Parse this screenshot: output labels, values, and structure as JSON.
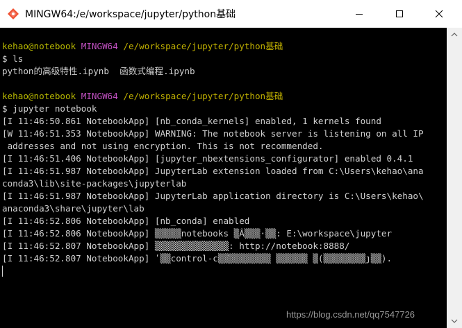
{
  "window": {
    "title": "MINGW64:/e/workspace/jupyter/python基础",
    "icon": "git-bash-diamond-icon",
    "controls": [
      "minimize-icon",
      "maximize-icon",
      "close-icon"
    ]
  },
  "colors": {
    "user": "#b8b800",
    "mingw": "#c050c0",
    "path": "#c0b000",
    "text": "#d0d0d0",
    "background": "#000000"
  },
  "terminal": {
    "prompt1": {
      "user": "kehao@notebook",
      "env": "MINGW64",
      "path": "/e/workspace/jupyter/python基础"
    },
    "cmd1": "$ ls",
    "out1": "python的高级特性.ipynb  函数式编程.ipynb",
    "prompt2": {
      "user": "kehao@notebook",
      "env": "MINGW64",
      "path": "/e/workspace/jupyter/python基础"
    },
    "cmd2": "$ jupyter notebook",
    "log": [
      "[I 11:46:50.861 NotebookApp] [nb_conda_kernels] enabled, 1 kernels found",
      "[W 11:46:51.353 NotebookApp] WARNING: The notebook server is listening on all IP",
      " addresses and not using encryption. This is not recommended.",
      "[I 11:46:51.406 NotebookApp] [jupyter_nbextensions_configurator] enabled 0.4.1",
      "[I 11:46:51.987 NotebookApp] JupyterLab extension loaded from C:\\Users\\kehao\\ana",
      "conda3\\lib\\site-packages\\jupyterlab",
      "[I 11:46:51.987 NotebookApp] JupyterLab application directory is C:\\Users\\kehao\\",
      "anaconda3\\share\\jupyter\\lab",
      "[I 11:46:52.806 NotebookApp] [nb_conda] enabled",
      "[I 11:46:52.806 NotebookApp] ▒▒▒▒▒notebooks ▒Â▒▒▒·▒▒: E:\\workspace\\jupyter",
      "[I 11:46:52.807 NotebookApp] ▒▒▒▒▒▒▒▒▒▒▒▒▒▒: http://notebook:8888/",
      "[I 11:46:52.807 NotebookApp] ʹ▒▒control-c▒▒ֹ▒▒▒▒▒▒▒▒ ▒▒▒▒▒▒ ▒(▒▒▒▒▒▒▒▒ȷ▒▒)."
    ]
  },
  "watermark": "https://blog.csdn.net/qq7547726"
}
